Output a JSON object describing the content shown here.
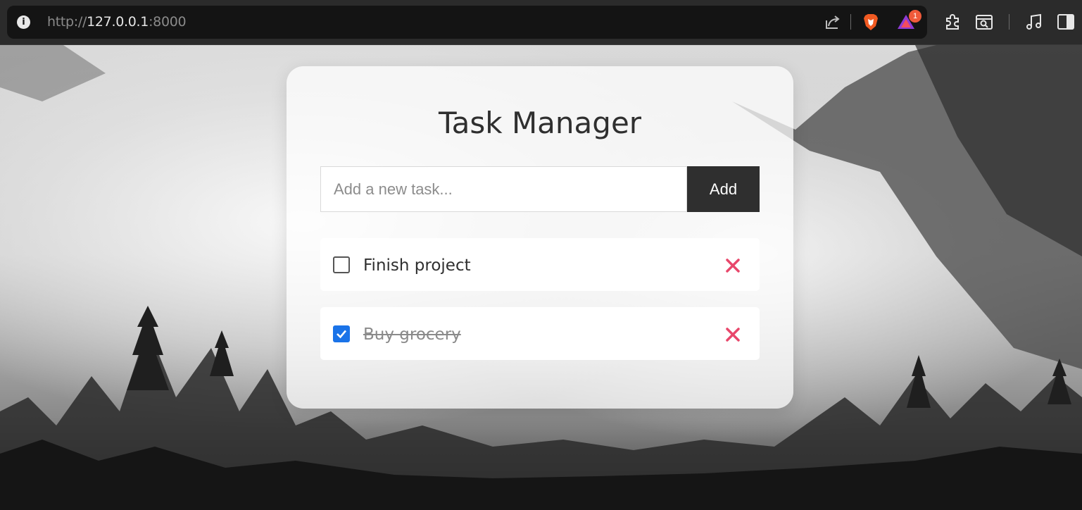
{
  "browser": {
    "url_scheme": "http://",
    "url_host": "127.0.0.1",
    "url_port": ":8000",
    "extension_badge": "1"
  },
  "app": {
    "title": "Task Manager",
    "input_placeholder": "Add a new task...",
    "input_value": "",
    "add_button_label": "Add"
  },
  "tasks": [
    {
      "label": "Finish project",
      "completed": false
    },
    {
      "label": "Buy grocery",
      "completed": true
    }
  ],
  "colors": {
    "delete_icon": "#e8476b",
    "checkbox_checked": "#1a73e8",
    "add_button": "#2f2f2f"
  }
}
